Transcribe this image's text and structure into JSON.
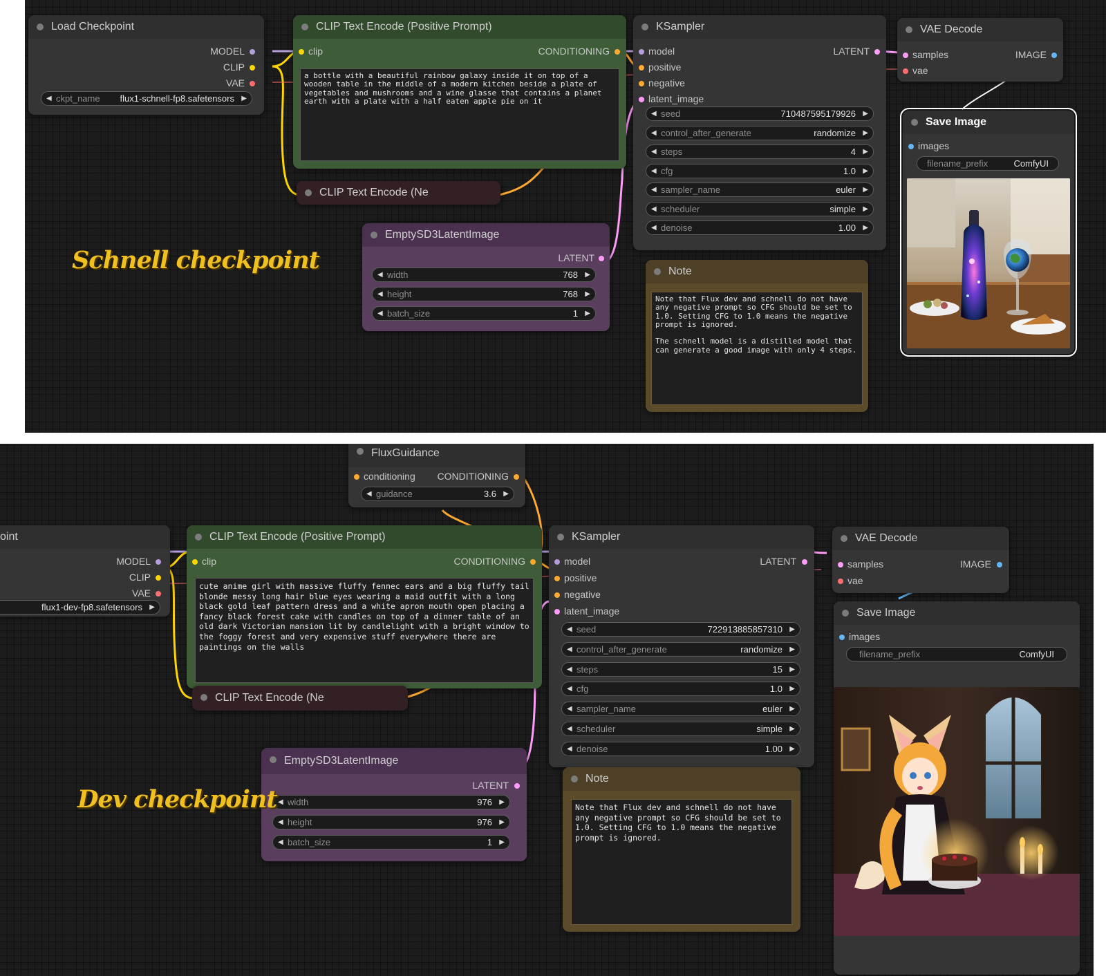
{
  "colors": {
    "model_wire": "#b39ddb",
    "clip_wire": "#ffd500",
    "vae_wire": "#ff6e6e",
    "conditioning_wire": "#ffa931",
    "latent_wire": "#ff9cf9",
    "image_wire": "#64b5f6",
    "caption": "#f0c020"
  },
  "top": {
    "caption": "Schnell checkpoint",
    "load_checkpoint": {
      "title": "Load Checkpoint",
      "outputs": [
        "MODEL",
        "CLIP",
        "VAE"
      ],
      "ckpt_label": "ckpt_name",
      "ckpt_value": "flux1-schnell-fp8.safetensors"
    },
    "clip_pos": {
      "title": "CLIP Text Encode (Positive Prompt)",
      "input": "clip",
      "output": "CONDITIONING",
      "text": "a bottle with a beautiful rainbow galaxy inside it on top of a wooden table in the middle of a modern kitchen beside a plate of vegetables and mushrooms and a wine glasse that contains a planet earth with a plate with a half eaten apple pie on it"
    },
    "clip_neg": {
      "title": "CLIP Text Encode (Ne"
    },
    "empty_latent": {
      "title": "EmptySD3LatentImage",
      "output": "LATENT",
      "widgets": [
        {
          "label": "width",
          "value": "768"
        },
        {
          "label": "height",
          "value": "768"
        },
        {
          "label": "batch_size",
          "value": "1"
        }
      ]
    },
    "ksampler": {
      "title": "KSampler",
      "inputs": [
        "model",
        "positive",
        "negative",
        "latent_image"
      ],
      "output": "LATENT",
      "widgets": [
        {
          "label": "seed",
          "value": "710487595179926"
        },
        {
          "label": "control_after_generate",
          "value": "randomize"
        },
        {
          "label": "steps",
          "value": "4"
        },
        {
          "label": "cfg",
          "value": "1.0"
        },
        {
          "label": "sampler_name",
          "value": "euler"
        },
        {
          "label": "scheduler",
          "value": "simple"
        },
        {
          "label": "denoise",
          "value": "1.00"
        }
      ]
    },
    "note": {
      "title": "Note",
      "text": "Note that Flux dev and schnell do not have any negative prompt so CFG should be set to 1.0. Setting CFG to 1.0 means the negative prompt is ignored.\n\nThe schnell model is a distilled model that can generate a good image with only 4 steps."
    },
    "vae_decode": {
      "title": "VAE Decode",
      "inputs": [
        "samples",
        "vae"
      ],
      "output": "IMAGE"
    },
    "save_image": {
      "title": "Save Image",
      "input": "images",
      "prefix_label": "filename_prefix",
      "prefix_value": "ComfyUI"
    }
  },
  "bottom": {
    "caption": "Dev checkpoint",
    "load_checkpoint": {
      "title": "oint",
      "outputs": [
        "MODEL",
        "CLIP",
        "VAE"
      ],
      "ckpt_value": "flux1-dev-fp8.safetensors"
    },
    "flux_guidance": {
      "title": "FluxGuidance",
      "input": "conditioning",
      "output": "CONDITIONING",
      "widget": {
        "label": "guidance",
        "value": "3.6"
      }
    },
    "clip_pos": {
      "title": "CLIP Text Encode (Positive Prompt)",
      "input": "clip",
      "output": "CONDITIONING",
      "text": "cute anime girl with massive fluffy fennec ears and a big fluffy tail blonde messy long hair blue eyes wearing a maid outfit with a long black gold leaf pattern dress and a white apron mouth open placing a fancy black forest cake with candles on top of a dinner table of an old dark Victorian mansion lit by candlelight with a bright window to the foggy forest and very expensive stuff everywhere there are paintings on the walls"
    },
    "clip_neg": {
      "title": "CLIP Text Encode (Ne"
    },
    "empty_latent": {
      "title": "EmptySD3LatentImage",
      "output": "LATENT",
      "widgets": [
        {
          "label": "width",
          "value": "976"
        },
        {
          "label": "height",
          "value": "976"
        },
        {
          "label": "batch_size",
          "value": "1"
        }
      ]
    },
    "ksampler": {
      "title": "KSampler",
      "inputs": [
        "model",
        "positive",
        "negative",
        "latent_image"
      ],
      "output": "LATENT",
      "widgets": [
        {
          "label": "seed",
          "value": "722913885857310"
        },
        {
          "label": "control_after_generate",
          "value": "randomize"
        },
        {
          "label": "steps",
          "value": "15"
        },
        {
          "label": "cfg",
          "value": "1.0"
        },
        {
          "label": "sampler_name",
          "value": "euler"
        },
        {
          "label": "scheduler",
          "value": "simple"
        },
        {
          "label": "denoise",
          "value": "1.00"
        }
      ]
    },
    "note": {
      "title": "Note",
      "text": "Note that Flux dev and schnell do not have any negative prompt so CFG should be set to 1.0. Setting CFG to 1.0 means the negative prompt is ignored."
    },
    "vae_decode": {
      "title": "VAE Decode",
      "inputs": [
        "samples",
        "vae"
      ],
      "output": "IMAGE"
    },
    "save_image": {
      "title": "Save Image",
      "input": "images",
      "prefix_label": "filename_prefix",
      "prefix_value": "ComfyUI"
    }
  }
}
